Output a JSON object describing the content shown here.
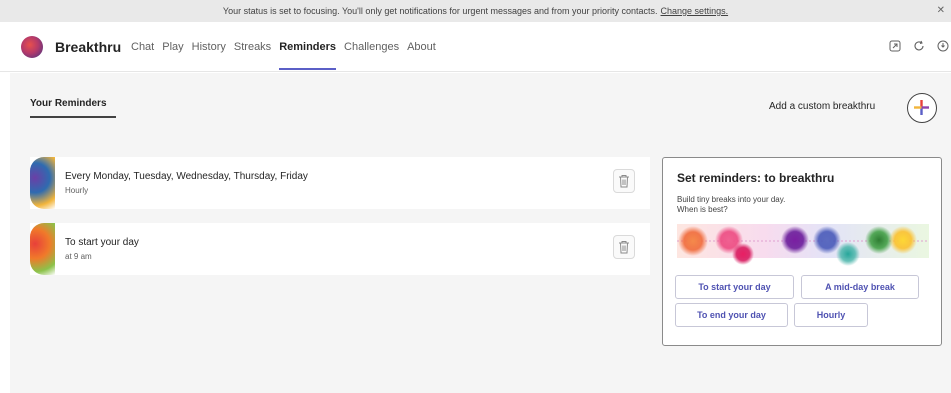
{
  "status_bar": {
    "message": "Your status is set to focusing. You'll only get notifications for urgent messages and from your priority contacts.",
    "link_label": "Change settings.",
    "dismiss_icon": "close-icon"
  },
  "app": {
    "title": "Breakthru",
    "logo_icon": "breakthru-logo-icon"
  },
  "nav": {
    "tabs": [
      {
        "label": "Chat",
        "active": false
      },
      {
        "label": "Play",
        "active": false
      },
      {
        "label": "History",
        "active": false
      },
      {
        "label": "Streaks",
        "active": false
      },
      {
        "label": "Reminders",
        "active": true
      },
      {
        "label": "Challenges",
        "active": false
      },
      {
        "label": "About",
        "active": false
      }
    ],
    "accent_color": "#5b5fc7"
  },
  "header_icons": [
    "popout-icon",
    "refresh-icon",
    "shield-icon"
  ],
  "reminders": {
    "heading": "Your Reminders",
    "add_label": "Add a custom breakthru",
    "add_icon": "plus-icon",
    "items": [
      {
        "title": "Every Monday, Tuesday, Wednesday, Thursday, Friday",
        "frequency": "Hourly",
        "delete_icon": "trash-icon"
      },
      {
        "title": "To start your day",
        "frequency": "at 9 am",
        "delete_icon": "trash-icon"
      }
    ]
  },
  "set_reminders": {
    "title": "Set reminders: to breakthru",
    "description_line1": "Build tiny breaks into your day.",
    "description_line2": "When is best?",
    "art_icon": "colorful-dots-illustration",
    "options": [
      "To start your day",
      "A mid-day break",
      "To end your day",
      "Hourly"
    ],
    "button_text_color": "#4f52b2"
  }
}
